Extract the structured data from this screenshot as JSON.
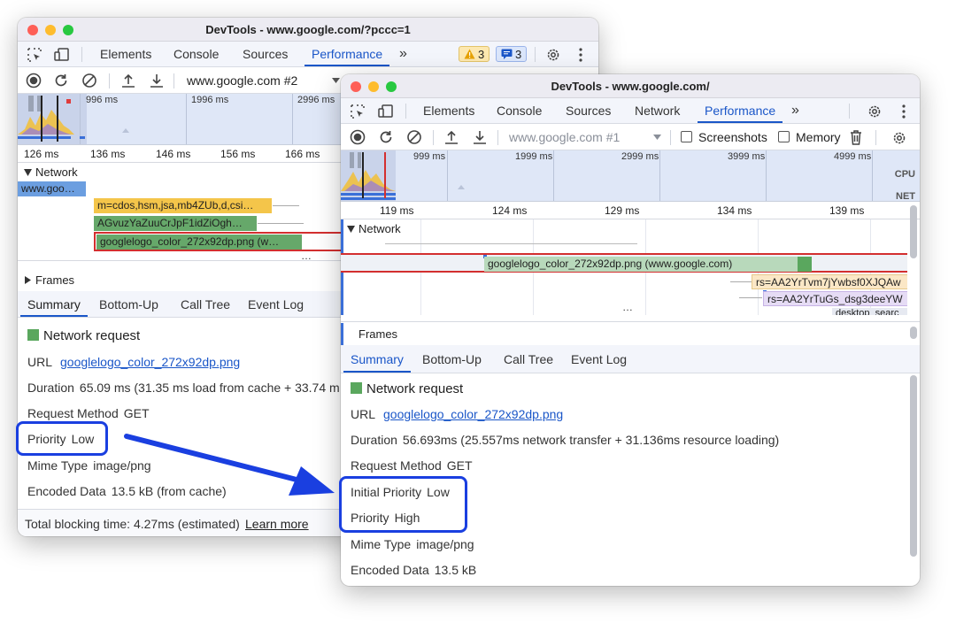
{
  "back": {
    "title": "DevTools - www.google.com/?pccc=1",
    "tabs": [
      "Elements",
      "Console",
      "Sources",
      "Performance",
      "»"
    ],
    "warn_count": "3",
    "msg_count": "3",
    "recording_select": "www.google.com #2",
    "overview_times": [
      "996 ms",
      "1996 ms",
      "2996 ms"
    ],
    "ruler": [
      "126 ms",
      "136 ms",
      "146 ms",
      "156 ms",
      "166 ms"
    ],
    "network_label": "Network",
    "requests": [
      "www.goo…",
      "m=cdos,hsm,jsa,mb4ZUb,d,csi…",
      "AGvuzYaZuuCrJpF1idZiOgh…",
      "googlelogo_color_272x92dp.png (w…"
    ],
    "ellipsis": "…",
    "frames_label": "Frames",
    "summary_tabs": [
      "Summary",
      "Bottom-Up",
      "Call Tree",
      "Event Log"
    ],
    "details": {
      "heading": "Network request",
      "url_label": "URL",
      "url_value": "googlelogo_color_272x92dp.png",
      "duration_label": "Duration",
      "duration_value": "65.09 ms (31.35 ms load from cache + 33.74 m",
      "method_label": "Request Method",
      "method_value": "GET",
      "priority_label": "Priority",
      "priority_value": "Low",
      "mime_label": "Mime Type",
      "mime_value": "image/png",
      "encoded_label": "Encoded Data",
      "encoded_value": "13.5 kB (from cache)"
    },
    "footer_text": "Total blocking time: 4.27ms (estimated)",
    "footer_link": "Learn more"
  },
  "front": {
    "title": "DevTools - www.google.com/",
    "tabs": [
      "Elements",
      "Console",
      "Sources",
      "Network",
      "Performance",
      "»"
    ],
    "recording_select": "www.google.com #1",
    "screenshots_label": "Screenshots",
    "memory_label": "Memory",
    "overview_times": [
      "999 ms",
      "1999 ms",
      "2999 ms",
      "3999 ms",
      "4999 ms"
    ],
    "cpu_label": "CPU",
    "net_label": "NET",
    "ruler": [
      "119 ms",
      "124 ms",
      "129 ms",
      "134 ms",
      "139 ms"
    ],
    "network_label": "Network",
    "requests": [
      "googlelogo_color_272x92dp.png (www.google.com)",
      "rs=AA2YrTvm7jYwbsf0XJQAw",
      "rs=AA2YrTuGs_dsg3deeYW",
      "desktop_searc"
    ],
    "ellipsis": "…",
    "frames_label": "Frames",
    "summary_tabs": [
      "Summary",
      "Bottom-Up",
      "Call Tree",
      "Event Log"
    ],
    "details": {
      "heading": "Network request",
      "url_label": "URL",
      "url_value": "googlelogo_color_272x92dp.png",
      "duration_label": "Duration",
      "duration_value": "56.693ms (25.557ms network transfer + 31.136ms resource loading)",
      "method_label": "Request Method",
      "method_value": "GET",
      "initial_priority_label": "Initial Priority",
      "initial_priority_value": "Low",
      "priority_label": "Priority",
      "priority_value": "High",
      "mime_label": "Mime Type",
      "mime_value": "image/png",
      "encoded_label": "Encoded Data",
      "encoded_value": "13.5 kB"
    }
  },
  "colors": {
    "accent": "#1a56c8",
    "highlight_annotation": "#1a3fe0",
    "mac_close": "#fe5f57",
    "mac_min": "#febc2e",
    "mac_max": "#28c840",
    "selected_request_outline": "#d32f2f"
  },
  "icons": [
    "inspect-element-icon",
    "device-toolbar-icon",
    "warning-icon",
    "message-icon",
    "settings-gear-icon",
    "kebab-menu-icon",
    "record-icon",
    "reload-icon",
    "clear-icon",
    "upload-icon",
    "download-icon",
    "dropdown-caret-icon",
    "trash-icon",
    "capture-settings-icon",
    "arrow-annotation"
  ]
}
